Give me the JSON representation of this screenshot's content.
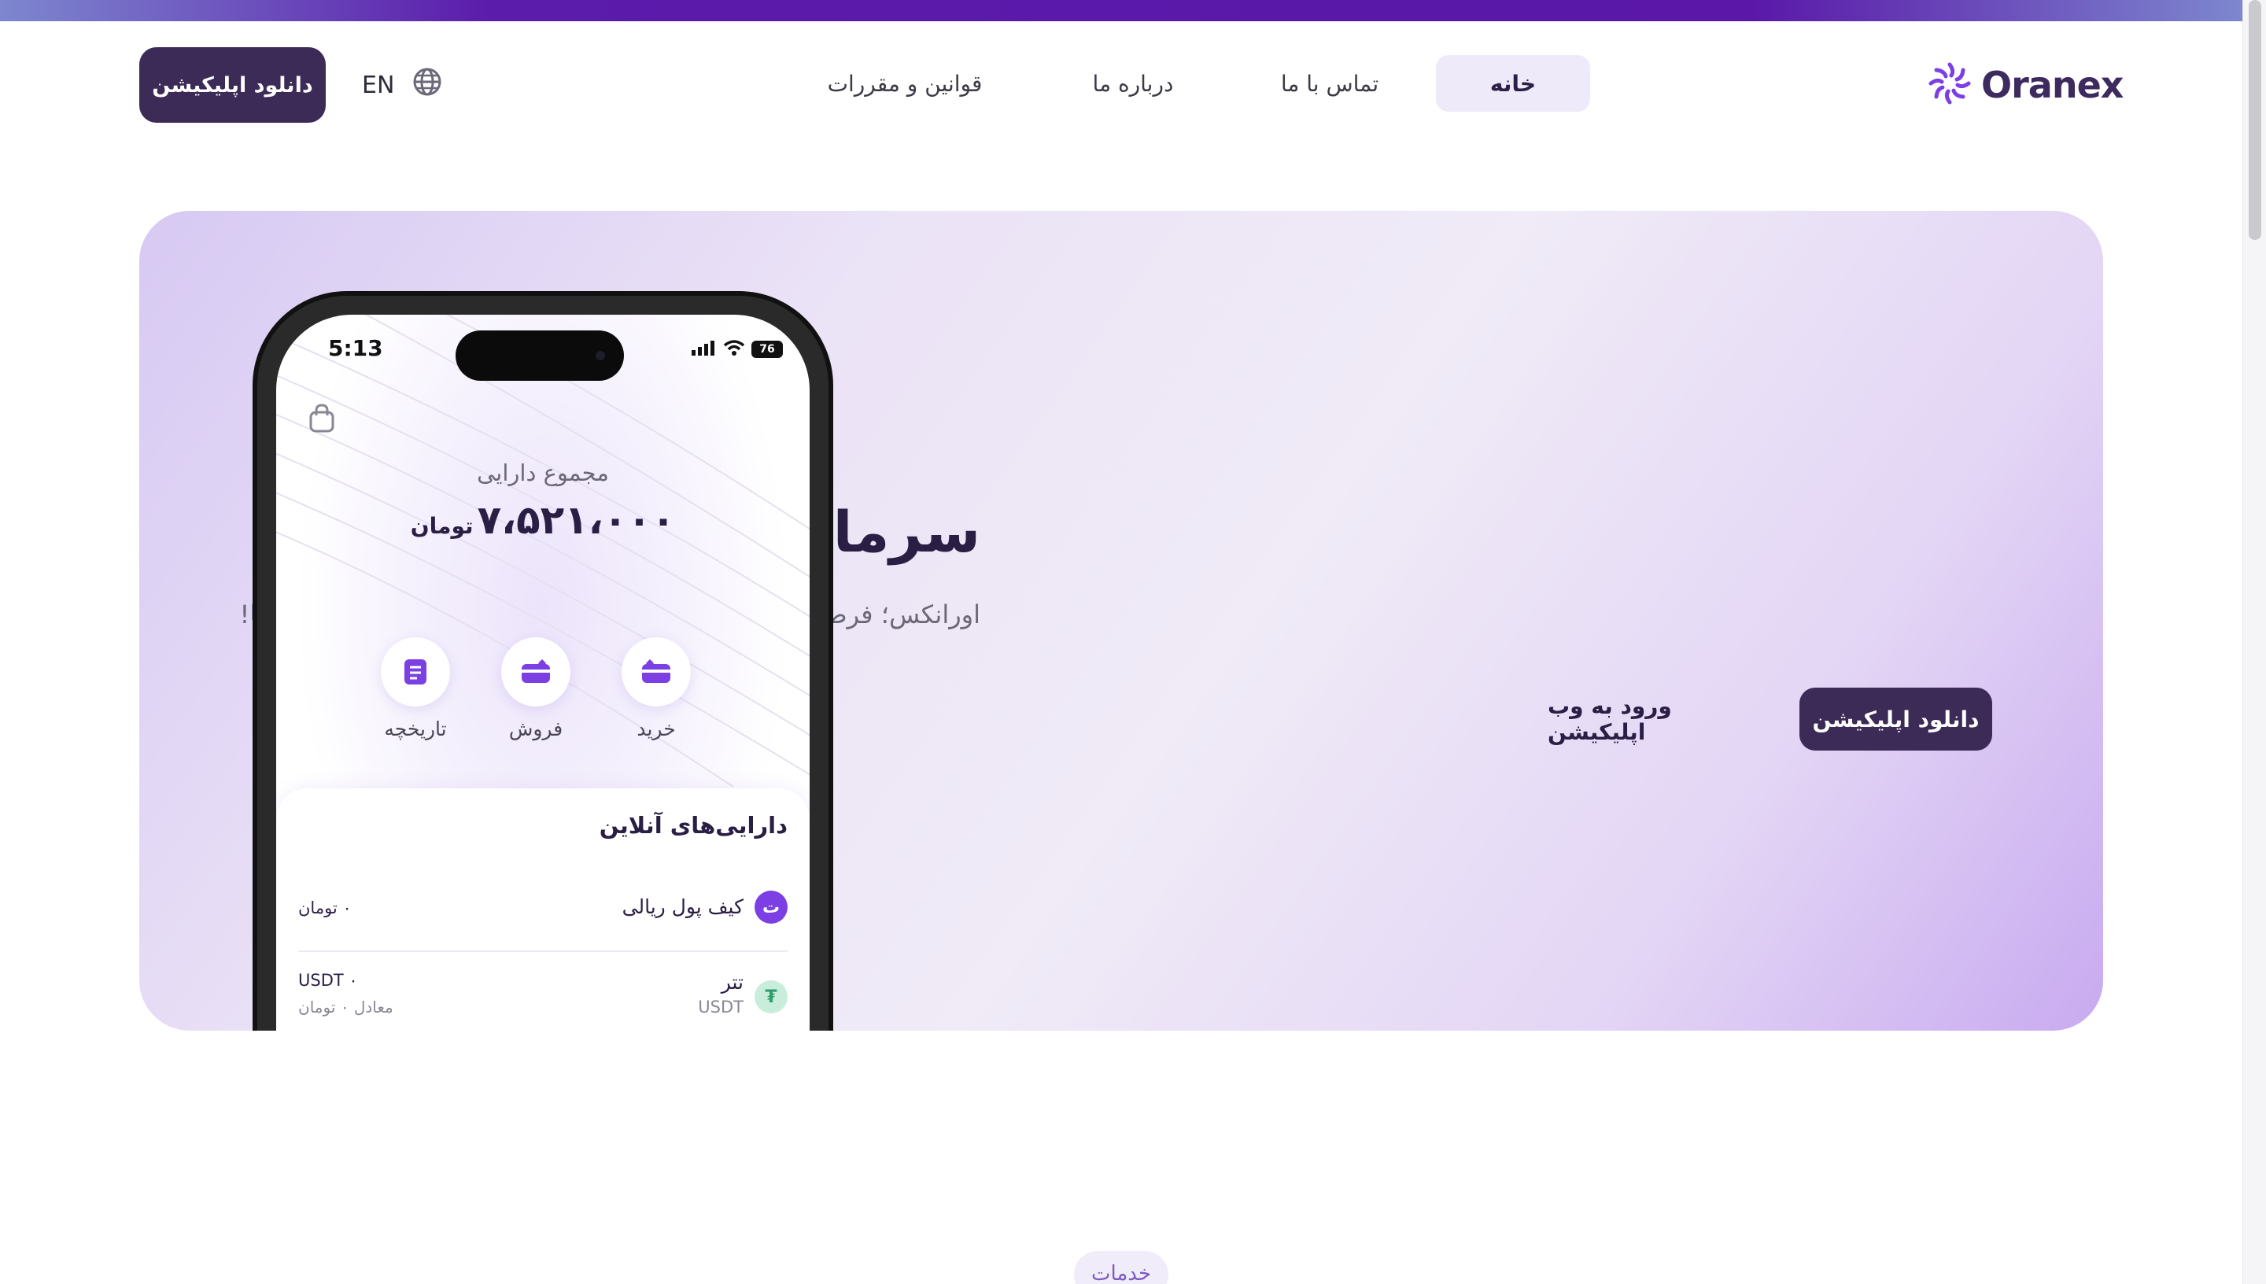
{
  "header": {
    "download_label": "دانلود اپلیکیشن",
    "lang_label": "EN",
    "nav": [
      {
        "label": "خانه",
        "active": true
      },
      {
        "label": "تماس با ما",
        "active": false
      },
      {
        "label": "درباره ما",
        "active": false
      },
      {
        "label": "قوانین و مقررات",
        "active": false
      }
    ],
    "logo_text": "Oranex"
  },
  "hero": {
    "title": "سرمایه گذاری به سبک تو",
    "subtitle": "اورانکس؛ فرصتی امن و آسوده برای سرمایه‌گذاری و مدیریت دارایی‌ها!",
    "download_label": "دانلود اپلیکیشن",
    "web_label": "ورود به وب اپلیکیشن"
  },
  "phone": {
    "time": "5:13",
    "battery": "76",
    "total_label": "مجموع دارایی",
    "total_value": "۷،۵۲۱،۰۰۰",
    "total_unit": "تومان",
    "actions": [
      {
        "label": "خرید",
        "icon": "card-in-icon"
      },
      {
        "label": "فروش",
        "icon": "card-out-icon"
      },
      {
        "label": "تاریخچه",
        "icon": "history-icon"
      }
    ],
    "assets_title": "دارایی‌های آنلاین",
    "assets": [
      {
        "name": "کیف پول ریالی",
        "symbol": "ت",
        "amount": "۰ تومان",
        "color": "#7b3fe4"
      },
      {
        "name": "تتر",
        "code": "USDT",
        "symbol": "₮",
        "amount": "USDT ۰",
        "equivalent": "معادل ۰ تومان",
        "color": "#c8eedb"
      }
    ]
  },
  "services_label": "خدمات",
  "colors": {
    "accent": "#3c2a57",
    "brand": "#5b1bab",
    "hero_bg": "#e9e1f6"
  }
}
